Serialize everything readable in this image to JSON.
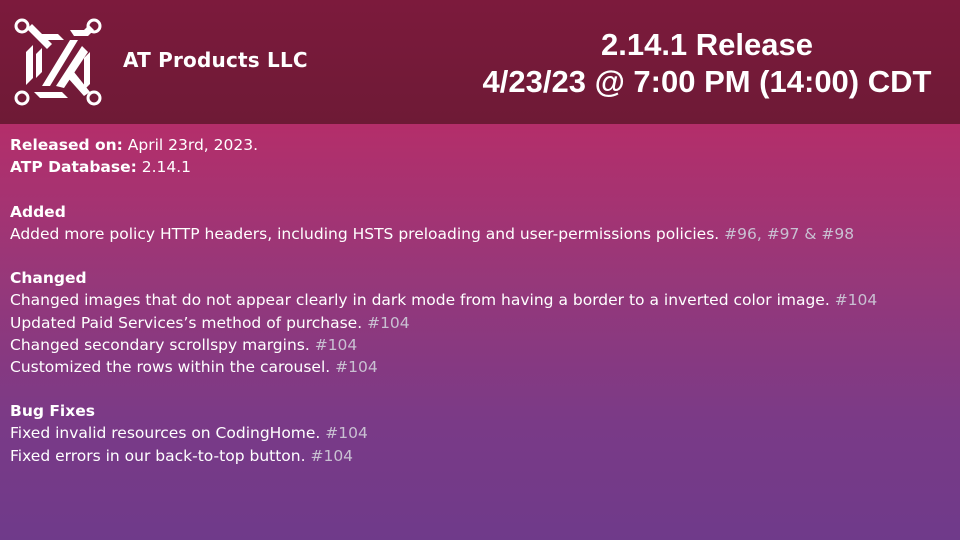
{
  "header": {
    "company_name": "AT Products LLC",
    "release_title": "2.14.1 Release",
    "release_datetime": "4/23/23 @ 7:00 PM (14:00) CDT"
  },
  "meta": {
    "released_label": "Released on:",
    "released_value": " April 23rd, 2023.",
    "db_label": "ATP Database:",
    "db_value": " 2.14.1"
  },
  "sections": {
    "added": {
      "heading": "Added",
      "items": [
        {
          "text": "Added more policy HTTP headers, including HSTS preloading and user-permissions policies. ",
          "ref": "#96, #97 & #98"
        }
      ]
    },
    "changed": {
      "heading": "Changed",
      "items": [
        {
          "text": "Changed images that do not appear clearly in dark mode from having a border to a inverted color image. ",
          "ref": "#104"
        },
        {
          "text": "Updated Paid Services’s method of purchase. ",
          "ref": "#104"
        },
        {
          "text": "Changed secondary scrollspy margins. ",
          "ref": "#104"
        },
        {
          "text": "Customized the rows within the carousel. ",
          "ref": "#104"
        }
      ]
    },
    "bug_fixes": {
      "heading": "Bug Fixes",
      "items": [
        {
          "text": "Fixed invalid resources on CodingHome. ",
          "ref": "#104"
        },
        {
          "text": "Fixed errors in our back-to-top button. ",
          "ref": "#104"
        }
      ]
    }
  },
  "colors": {
    "header_bg": "#7c1a3c",
    "content_gradient_top": "#b42e6a",
    "content_gradient_bottom": "#6f3a8a",
    "reference_text": "#c9c0d2",
    "text": "#ffffff"
  }
}
